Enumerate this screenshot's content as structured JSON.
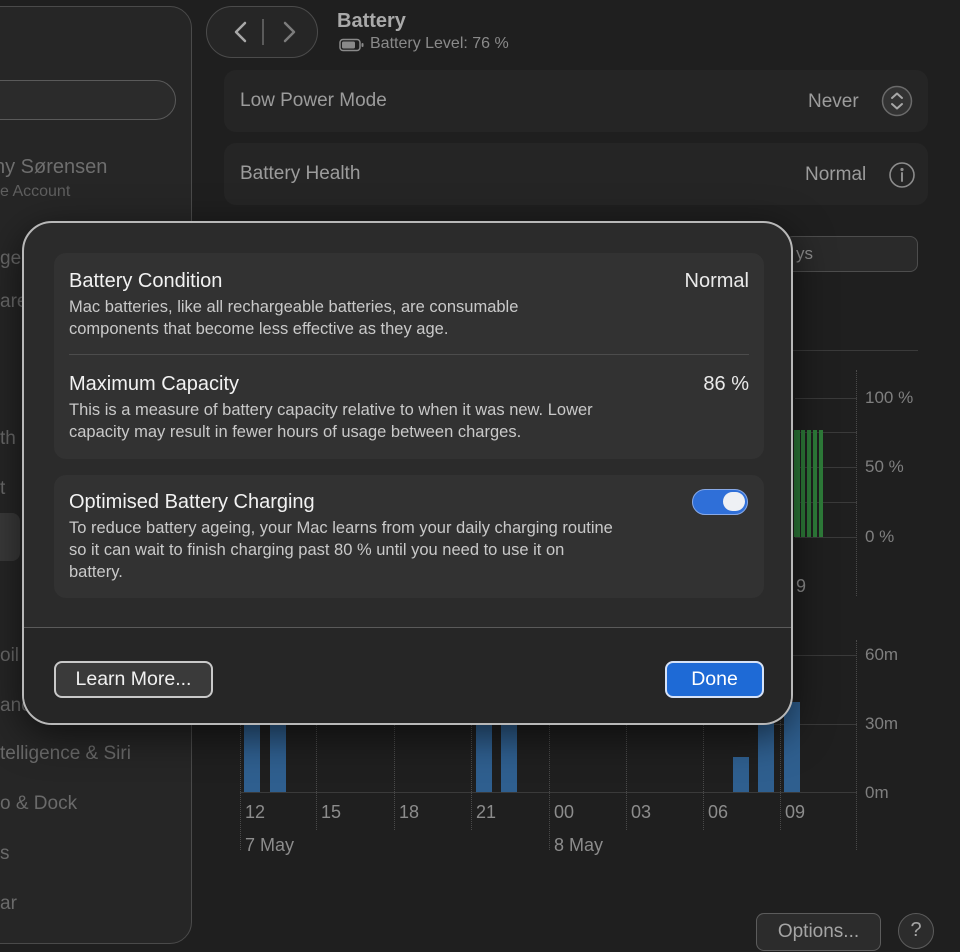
{
  "window": {
    "title": "Battery",
    "subtitle": "Battery Level: 76 %"
  },
  "sidebar": {
    "user_name": "ny Sørensen",
    "user_sub": "e Account",
    "partial_items": [
      "ge",
      "are",
      "th",
      "t",
      "oil",
      "anc",
      "telligence & Siri",
      "o & Dock",
      "s",
      "ar"
    ]
  },
  "settings": {
    "low_power_mode": {
      "label": "Low Power Mode",
      "value": "Never"
    },
    "battery_health": {
      "label": "Battery Health",
      "value": "Normal"
    }
  },
  "chart_visible": {
    "segment_partial": "ys",
    "level_axis": [
      "100 %",
      "50 %",
      "0 %"
    ],
    "level_x_partial": "9",
    "screen_axis": [
      "60m",
      "30m",
      "0m"
    ],
    "x_ticks": [
      "12",
      "15",
      "18",
      "21",
      "00",
      "03",
      "06",
      "09"
    ],
    "date_labels": [
      "7 May",
      "8 May"
    ]
  },
  "sheet": {
    "condition": {
      "title": "Battery Condition",
      "value": "Normal",
      "description_line1": "Mac batteries, like all rechargeable batteries, are consumable",
      "description_line2": "components that become less effective as they age."
    },
    "capacity": {
      "title": "Maximum Capacity",
      "value": "86 %",
      "description_line1": "This is a measure of battery capacity relative to when it was new. Lower",
      "description_line2": "capacity may result in fewer hours of usage between charges."
    },
    "optimised": {
      "title": "Optimised Battery Charging",
      "enabled": true,
      "description_line1": "To reduce battery ageing, your Mac learns from your daily charging routine",
      "description_line2": "so it can wait to finish charging past 80 % until you need to use it on",
      "description_line3": "battery."
    },
    "learn_more_label": "Learn More...",
    "done_label": "Done"
  },
  "footer": {
    "options_label": "Options...",
    "help_label": "?"
  },
  "colors": {
    "accent": "#1e6ad6",
    "level_bars": "#2e7d3a",
    "usage_bars": "#2f5f8f"
  }
}
